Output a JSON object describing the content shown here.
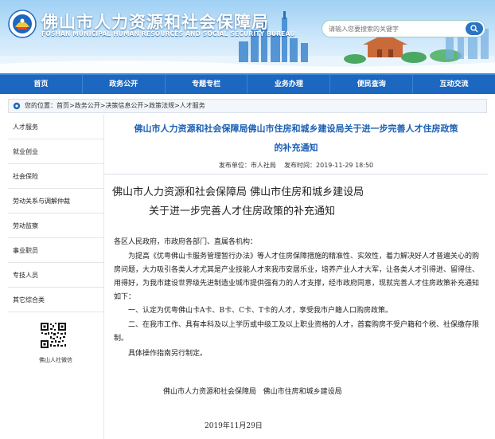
{
  "header": {
    "title": "佛山市人力资源和社会保障局",
    "subtitle": "FOSHAN MUNICIPAL HUMAN RESOURCES AND SOCIAL SECURITY BUREAU",
    "search_placeholder": "请输入您要搜索的关键字"
  },
  "nav": [
    "首页",
    "政务公开",
    "专题专栏",
    "业务办理",
    "便民查询",
    "互动交流"
  ],
  "breadcrumb": "您的位置：首页>政务公开>决策信息公开>政策法规>人才服务",
  "sidebar": {
    "items": [
      "人才服务",
      "就业创业",
      "社会保险",
      "劳动关系与调解仲裁",
      "劳动监察",
      "事业职员",
      "专技人员",
      "其它综合类"
    ],
    "qr_caption": "佛山人社微信"
  },
  "article": {
    "title_line1": "佛山市人力资源和社会保障局佛山市住房和城乡建设局关于进一步完善人才住房政策",
    "title_line2": "的补充通知",
    "meta": "发布单位：市人社局    发布时间：2019-11-29 18:50",
    "doc_heading_1": "佛山市人力资源和社会保障局 佛山市住房和城乡建设局",
    "doc_heading_2": "关于进一步完善人才住房政策的补充通知",
    "salutation": "各区人民政府，市政府各部门、直属各机构：",
    "para_1": "为提高《优粤佛山卡服务管理暂行办法》等人才住房保障措施的精准性、实效性，着力解决好人才普遍关心的购房问题，大力吸引各类人才尤其是产业技能人才来我市安居乐业，培养产业人才大军，让各类人才引得进、留得住、用得好，为我市建设世界级先进制造业城市提供强有力的人才支撑，经市政府同意，现就完善人才住房政策补充通知如下：",
    "para_2": "一、认定为优粤佛山卡A卡、B卡、C卡、T卡的人才，享受我市户籍人口购房政策。",
    "para_3": "二、在我市工作、具有本科及以上学历或中级工及以上职业资格的人才，首套购房不受户籍和个税、社保缴存限制。",
    "para_4": "具体操作指南另行制定。",
    "signature": "佛山市人力资源和社会保障局   佛山市住房和城乡建设局",
    "date": "2019年11月29日"
  }
}
